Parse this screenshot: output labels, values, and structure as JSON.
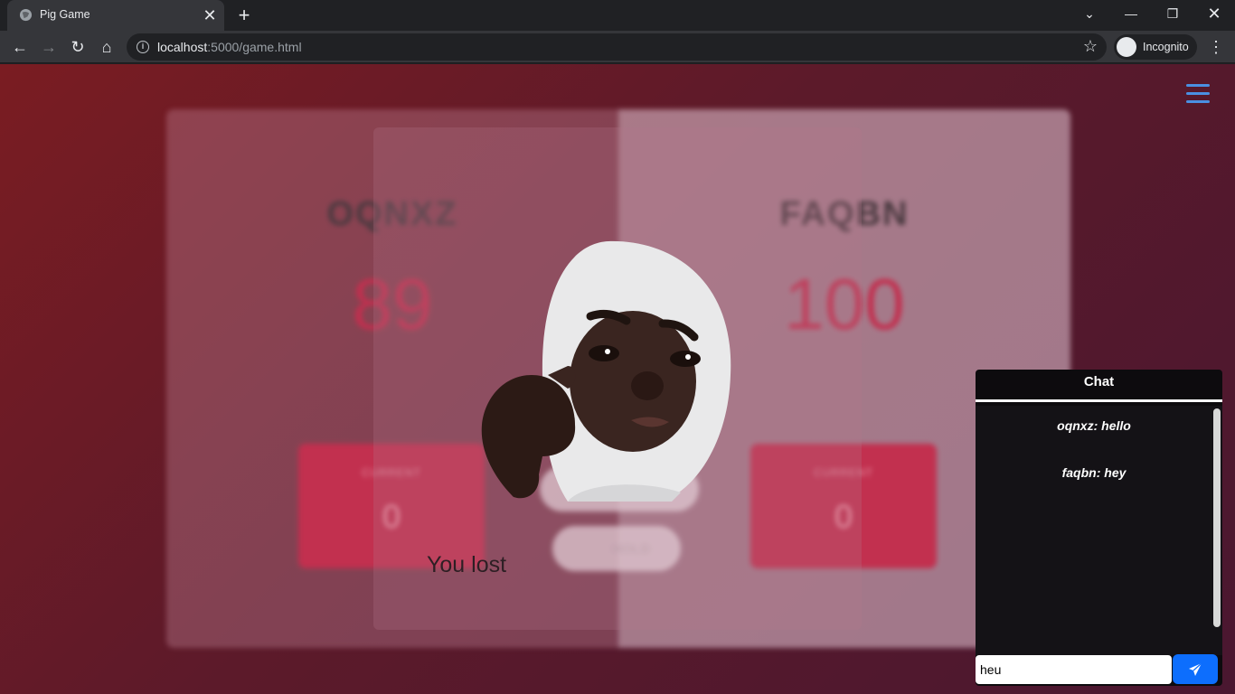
{
  "browser": {
    "tab_title": "Pig Game",
    "url_host": "localhost",
    "url_path": ":5000/game.html",
    "profile_label": "Incognito"
  },
  "game": {
    "player1": {
      "name": "OQNXZ",
      "score": "89",
      "current_label": "CURRENT",
      "current": "0"
    },
    "player2": {
      "name": "FAQBN",
      "score": "100",
      "current_label": "CURRENT",
      "current": "0"
    },
    "hold_label": "HOLD",
    "result_text": "You lost"
  },
  "chat": {
    "title": "Chat",
    "messages": [
      "oqnxz: hello",
      "faqbn: hey"
    ],
    "input_value": "heu"
  },
  "colors": {
    "accent_blue": "#0d6efd",
    "menu_blue": "#4a90e2",
    "score_red": "#c2304f"
  }
}
